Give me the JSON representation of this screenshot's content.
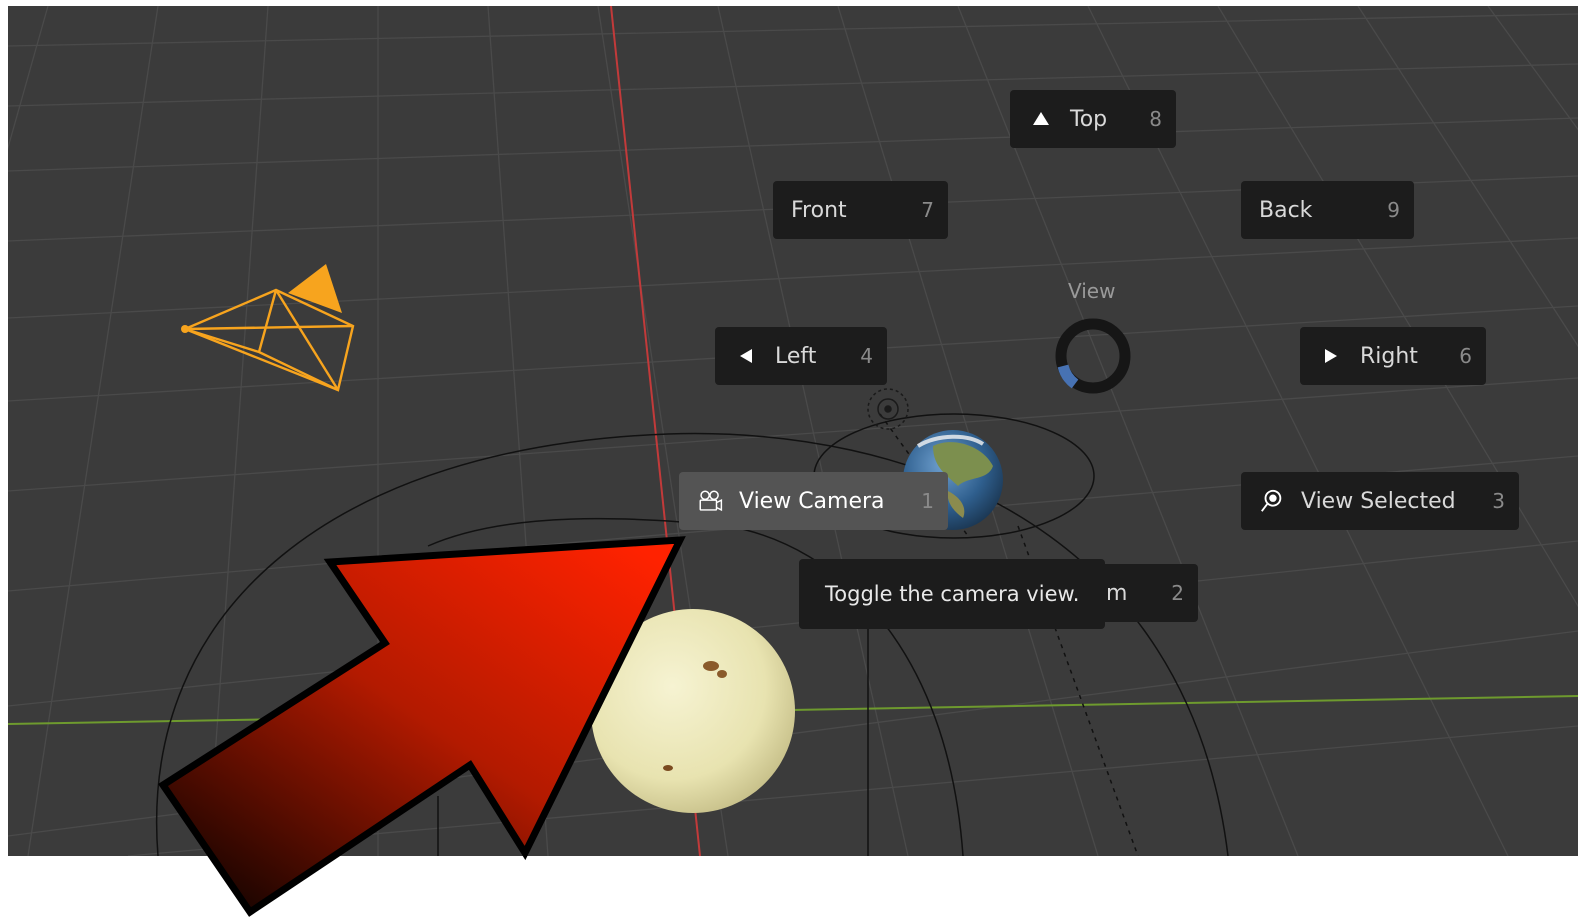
{
  "viewport": {
    "background": "#3b3b3b",
    "x_axis_color": "#d04141",
    "y_axis_color": "#6e9a2e"
  },
  "pie_menu": {
    "title": "View",
    "buttons": {
      "top": {
        "label": "Top",
        "key": "8",
        "icon": "triangle-up-icon"
      },
      "front": {
        "label": "Front",
        "key": "7"
      },
      "back": {
        "label": "Back",
        "key": "9"
      },
      "left": {
        "label": "Left",
        "key": "4",
        "icon": "triangle-left-icon"
      },
      "right": {
        "label": "Right",
        "key": "6",
        "icon": "triangle-right-icon"
      },
      "camera": {
        "label": "View Camera",
        "key": "1",
        "icon": "camera-icon"
      },
      "selected": {
        "label": "View Selected",
        "key": "3",
        "icon": "view-selected-icon"
      },
      "bottom": {
        "label_visible": "m",
        "key": "2"
      }
    }
  },
  "tooltip": {
    "text": "Toggle the camera view."
  },
  "annotation": {
    "arrow_colors": [
      "#ff2200",
      "#1a0400"
    ]
  }
}
